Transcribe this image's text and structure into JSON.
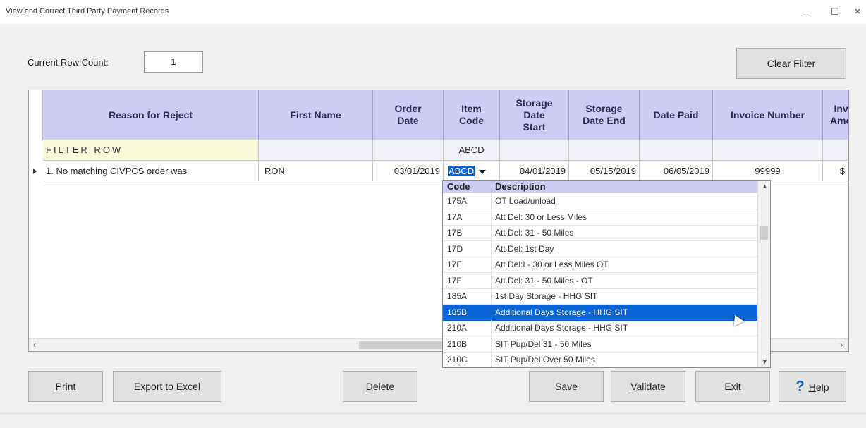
{
  "window": {
    "title": "View and Correct Third Party Payment Records",
    "min": "–",
    "max": "☐",
    "close": "×"
  },
  "toolbar": {
    "row_count_label": "Current Row Count:",
    "row_count_value": "1",
    "clear_filter": "Clear Filter"
  },
  "grid": {
    "columns": [
      "Reason for Reject",
      "First Name",
      "Order Date",
      "Item Code",
      "Storage Date Start",
      "Storage Date End",
      "Date Paid",
      "Invoice Number",
      "Inv Amo"
    ],
    "filter_row": {
      "label": "FILTER ROW",
      "item_code": "ABCD"
    },
    "rows": [
      {
        "reason": "1. No matching CIVPCS order was",
        "first_name": "RON",
        "order_date": "03/01/2019",
        "item_code": "ABCD",
        "storage_start": "04/01/2019",
        "storage_end": "05/15/2019",
        "date_paid": "06/05/2019",
        "invoice_number": "99999",
        "inv_amount": "$"
      }
    ]
  },
  "dropdown": {
    "header_code": "Code",
    "header_desc": "Description",
    "items": [
      {
        "code": "175A",
        "desc": "OT Load/unload"
      },
      {
        "code": "17A",
        "desc": "Att Del:  30 or Less Miles"
      },
      {
        "code": "17B",
        "desc": "Att Del: 31 - 50 Miles"
      },
      {
        "code": "17D",
        "desc": "Att Del: 1st Day"
      },
      {
        "code": "17E",
        "desc": "Att Del:I - 30 or Less Miles OT"
      },
      {
        "code": "17F",
        "desc": "Att Del: 31 - 50 Miles - OT"
      },
      {
        "code": "185A",
        "desc": "1st Day Storage - HHG SIT"
      },
      {
        "code": "185B",
        "desc": "Additional Days Storage - HHG SIT"
      },
      {
        "code": "210A",
        "desc": "Additional Days Storage - HHG SIT"
      },
      {
        "code": "210B",
        "desc": "SIT Pup/Del 31 - 50 Miles"
      },
      {
        "code": "210C",
        "desc": "SIT Pup/Del Over 50 Miles"
      }
    ],
    "selected_code": "185B"
  },
  "buttons": {
    "print": {
      "pre": "",
      "acc": "P",
      "post": "rint"
    },
    "export": {
      "pre": "Export to ",
      "acc": "E",
      "post": "xcel"
    },
    "delete": {
      "pre": "",
      "acc": "D",
      "post": "elete"
    },
    "save": {
      "pre": "",
      "acc": "S",
      "post": "ave"
    },
    "validate": {
      "pre": "",
      "acc": "V",
      "post": "alidate"
    },
    "exit": {
      "pre": "E",
      "acc": "x",
      "post": "it"
    },
    "help": {
      "icon": "?",
      "pre": "",
      "acc": "H",
      "post": "elp"
    }
  }
}
